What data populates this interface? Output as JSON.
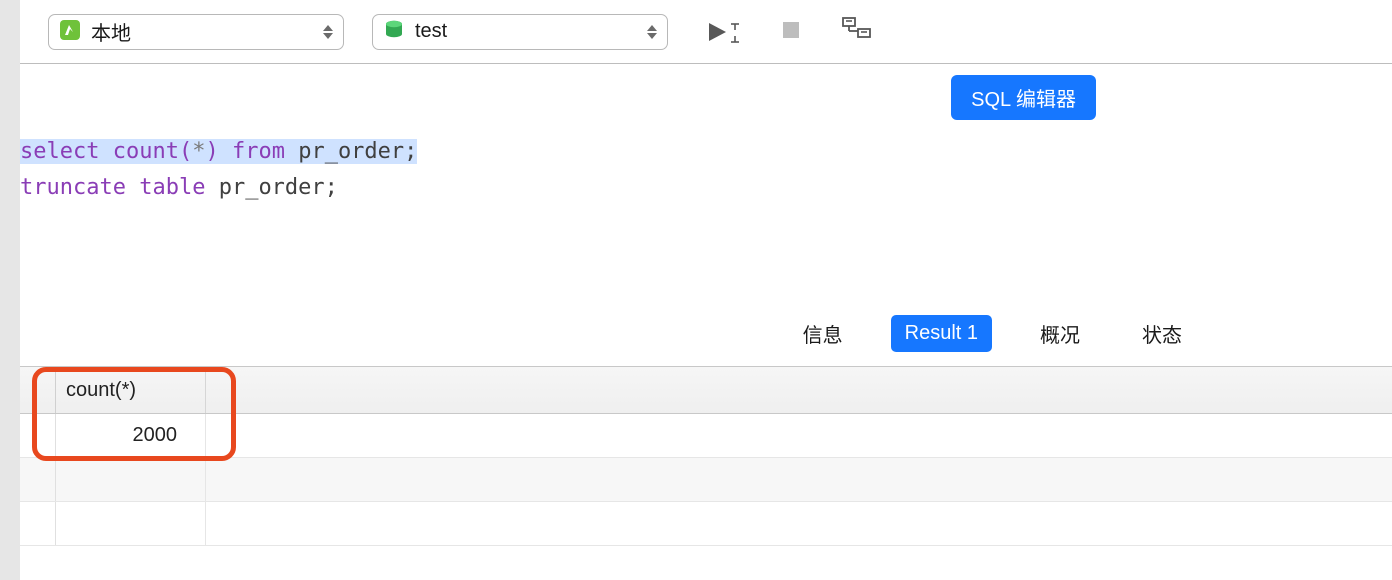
{
  "toolbar": {
    "connection": {
      "label": "本地"
    },
    "database": {
      "label": "test"
    }
  },
  "sql_editor_button": "SQL 编辑器",
  "editor": {
    "line1": {
      "kw1": "select",
      "fn": "count",
      "open": "(",
      "star": "*",
      "close": ")",
      "kw2": "from",
      "tbl": "pr_order",
      "semi": ";"
    },
    "line2": {
      "kw1": "truncate",
      "kw2": "table",
      "tbl": "pr_order",
      "semi": ";"
    }
  },
  "tabs": {
    "info": "信息",
    "result": "Result 1",
    "profile": "概况",
    "status": "状态"
  },
  "result": {
    "columns": [
      "count(*)"
    ],
    "rows": [
      [
        "2000"
      ]
    ]
  }
}
